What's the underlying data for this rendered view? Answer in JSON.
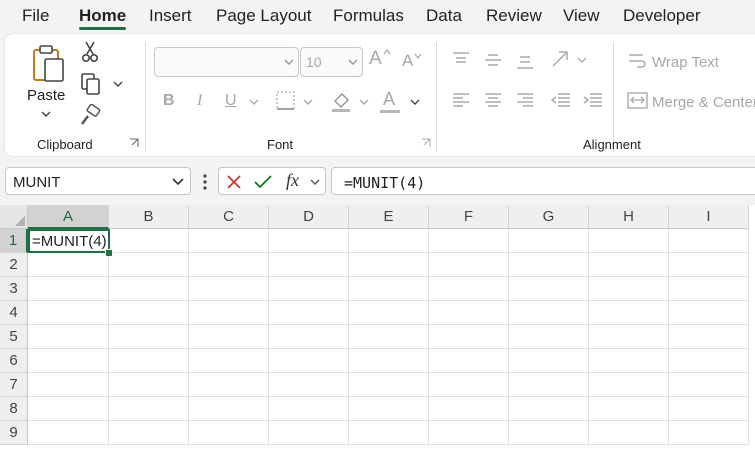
{
  "menu": {
    "tabs": [
      "File",
      "Home",
      "Insert",
      "Page Layout",
      "Formulas",
      "Data",
      "Review",
      "View",
      "Developer"
    ],
    "active": "Home"
  },
  "ribbon": {
    "clipboard": {
      "paste_label": "Paste",
      "group_label": "Clipboard"
    },
    "font": {
      "font_name": "",
      "font_size": "10",
      "grow_label": "A",
      "shrink_label": "A",
      "bold": "B",
      "italic": "I",
      "underline": "U",
      "font_color_label": "A",
      "group_label": "Font"
    },
    "alignment": {
      "wrap_text": "Wrap Text",
      "merge_center": "Merge & Center",
      "group_label": "Alignment"
    }
  },
  "formula_bar": {
    "name_box": "MUNIT",
    "fx_label": "fx",
    "formula": "=MUNIT(4)"
  },
  "sheet": {
    "columns": [
      "A",
      "B",
      "C",
      "D",
      "E",
      "F",
      "G",
      "H",
      "I"
    ],
    "rows": [
      "1",
      "2",
      "3",
      "4",
      "5",
      "6",
      "7",
      "8",
      "9"
    ],
    "selected_column": "A",
    "selected_row": "1",
    "cell_A1": "=MUNIT(4)"
  },
  "colors": {
    "accent": "#1e7145",
    "cancel": "#d13438",
    "enter": "#107c10"
  }
}
